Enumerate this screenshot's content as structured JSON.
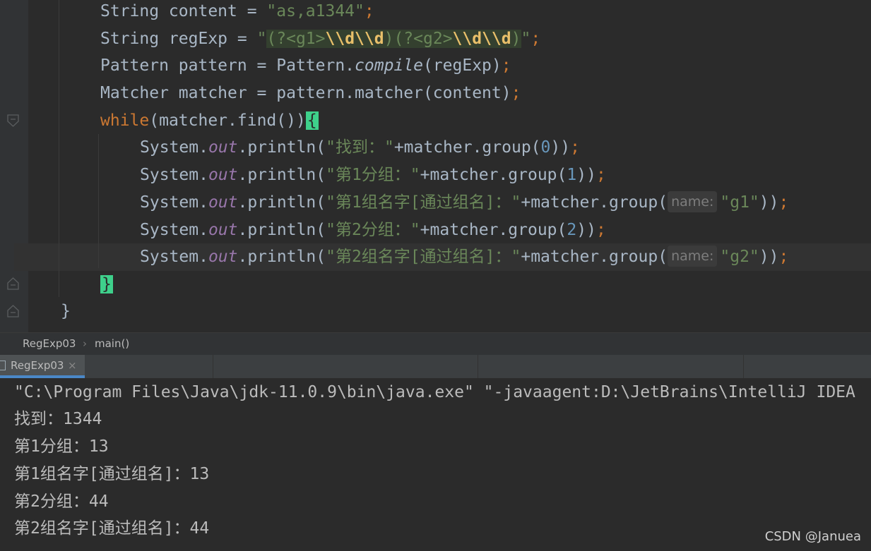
{
  "editor": {
    "lines": [
      {
        "indent": "        ",
        "parts": [
          [
            "plain",
            "String content = "
          ],
          [
            "str",
            "\"as,a1344\""
          ],
          [
            "kw",
            ";"
          ]
        ]
      },
      {
        "indent": "        ",
        "parts": [
          [
            "plain",
            "String regExp = "
          ],
          [
            "str",
            "\""
          ]
        ]
      },
      {
        "indent": "        ",
        "parts": [
          [
            "plain",
            "Pattern pattern = Pattern."
          ],
          [
            "italic",
            "compile"
          ],
          [
            "plain",
            "(regExp)"
          ],
          [
            "kw",
            ";"
          ]
        ]
      },
      {
        "indent": "        ",
        "parts": [
          [
            "plain",
            "Matcher matcher = pattern.matcher(content)"
          ],
          [
            "kw",
            ";"
          ]
        ]
      },
      {
        "indent": "        ",
        "parts": [
          [
            "kw",
            "while"
          ],
          [
            "plain",
            "(matcher.find())"
          ]
        ]
      },
      {
        "indent": "            ",
        "parts": [
          [
            "plain",
            "System."
          ],
          [
            "field",
            "out"
          ],
          [
            "plain",
            ".println("
          ],
          [
            "str",
            "\"找到：\""
          ],
          [
            "plain",
            "+matcher.group("
          ],
          [
            "num",
            "0"
          ],
          [
            "plain",
            "))"
          ],
          [
            "kw",
            ";"
          ]
        ]
      },
      {
        "indent": "            ",
        "parts": [
          [
            "plain",
            "System."
          ],
          [
            "field",
            "out"
          ],
          [
            "plain",
            ".println("
          ],
          [
            "str",
            "\"第1分组：\""
          ],
          [
            "plain",
            "+matcher.group("
          ],
          [
            "num",
            "1"
          ],
          [
            "plain",
            "))"
          ],
          [
            "kw",
            ";"
          ]
        ]
      },
      {
        "indent": "            ",
        "parts": [
          [
            "plain",
            "System."
          ],
          [
            "field",
            "out"
          ],
          [
            "plain",
            ".println("
          ],
          [
            "str",
            "\"第1组名字[通过组名]：\""
          ],
          [
            "plain",
            "+matcher.group("
          ]
        ]
      },
      {
        "indent": "            ",
        "parts": [
          [
            "plain",
            "System."
          ],
          [
            "field",
            "out"
          ],
          [
            "plain",
            ".println("
          ],
          [
            "str",
            "\"第2分组：\""
          ],
          [
            "plain",
            "+matcher.group("
          ],
          [
            "num",
            "2"
          ],
          [
            "plain",
            "))"
          ],
          [
            "kw",
            ";"
          ]
        ]
      },
      {
        "indent": "            ",
        "parts": [
          [
            "plain",
            "System."
          ],
          [
            "field",
            "out"
          ],
          [
            "plain",
            ".println("
          ],
          [
            "str",
            "\"第2组名字[通过组名]：\""
          ],
          [
            "plain",
            "+matcher.group("
          ]
        ]
      }
    ],
    "regex_body": "(?<g1>\\\\d\\\\d)(?<g2>\\\\d\\\\d)",
    "regex_segments": [
      [
        "plain",
        "(?<g1>"
      ],
      [
        "meta",
        "\\\\d\\\\d"
      ],
      [
        "plain",
        ")(?<g2>"
      ],
      [
        "meta",
        "\\\\d\\\\d"
      ],
      [
        "plain",
        ")"
      ]
    ],
    "regex_close": "\"",
    "semicolon": ";",
    "open_brace": "{",
    "close_brace_inner": "}",
    "close_brace_outer": "}",
    "hint_name": "name:",
    "g1_arg": "\"g1\"",
    "g2_arg": "\"g2\"",
    "call_close": "))",
    "colors": {
      "keyword": "#cc7832",
      "string": "#6a8759",
      "number": "#6897bb",
      "field": "#9876aa",
      "text": "#a9b7c6",
      "brace_highlight": "#3ed08b"
    }
  },
  "breadcrumb": {
    "file": "RegExp03",
    "separator": "›",
    "method": "main()"
  },
  "run_panel": {
    "tab_label": "RegExp03",
    "close_glyph": "×",
    "tab_icon": "console-icon"
  },
  "console": {
    "lines": [
      "\"C:\\Program Files\\Java\\jdk-11.0.9\\bin\\java.exe\" \"-javaagent:D:\\JetBrains\\IntelliJ IDEA",
      "找到：1344",
      "第1分组：13",
      "第1组名字[通过组名]：13",
      "第2分组：44",
      "第2组名字[通过组名]：44"
    ]
  },
  "watermark": "CSDN @Januea"
}
